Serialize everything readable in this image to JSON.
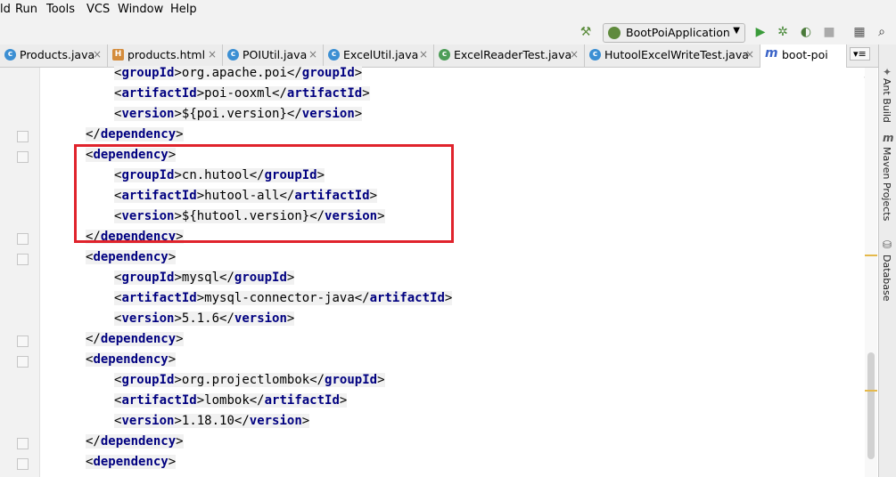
{
  "menu": [
    "Run",
    "Tools",
    "VCS",
    "Window",
    "Help"
  ],
  "menu_partial": "ld",
  "run_config": {
    "label": "BootPoiApplication"
  },
  "toolbar_icons": [
    "hammer-icon",
    "run-icon",
    "debug-icon",
    "coverage-icon",
    "stop-icon",
    "project-structure-icon",
    "search-icon"
  ],
  "tabs": [
    {
      "label": "Products.java",
      "type": "java"
    },
    {
      "label": "products.html",
      "type": "html"
    },
    {
      "label": "POIUtil.java",
      "type": "java"
    },
    {
      "label": "ExcelUtil.java",
      "type": "java"
    },
    {
      "label": "ExcelReaderTest.java",
      "type": "java"
    },
    {
      "label": "HutoolExcelWriteTest.java",
      "type": "java"
    },
    {
      "label": "boot-poi",
      "type": "maven"
    }
  ],
  "tab_overflow": "▾≡",
  "side_tabs": [
    "Ant Build",
    "Maven Projects",
    "Database"
  ],
  "code": [
    {
      "indent": 2,
      "tag": "groupId",
      "value": "org.apache.poi"
    },
    {
      "indent": 2,
      "tag": "artifactId",
      "value": "poi-ooxml"
    },
    {
      "indent": 2,
      "tag": "version",
      "value": "${poi.version}"
    },
    {
      "indent": 1,
      "close": "dependency"
    },
    {
      "indent": 1,
      "open": "dependency"
    },
    {
      "indent": 2,
      "tag": "groupId",
      "value": "cn.hutool"
    },
    {
      "indent": 2,
      "tag": "artifactId",
      "value": "hutool-all"
    },
    {
      "indent": 2,
      "tag": "version",
      "value": "${hutool.version}"
    },
    {
      "indent": 1,
      "close": "dependency"
    },
    {
      "indent": 1,
      "open": "dependency"
    },
    {
      "indent": 2,
      "tag": "groupId",
      "value": "mysql"
    },
    {
      "indent": 2,
      "tag": "artifactId",
      "value": "mysql-connector-java"
    },
    {
      "indent": 2,
      "tag": "version",
      "value": "5.1.6"
    },
    {
      "indent": 1,
      "close": "dependency"
    },
    {
      "indent": 1,
      "open": "dependency"
    },
    {
      "indent": 2,
      "tag": "groupId",
      "value": "org.projectlombok"
    },
    {
      "indent": 2,
      "tag": "artifactId",
      "value": "lombok"
    },
    {
      "indent": 2,
      "tag": "version",
      "value": "1.18.10"
    },
    {
      "indent": 1,
      "close": "dependency"
    },
    {
      "indent": 1,
      "open": "dependency"
    }
  ],
  "colors": {
    "tag": "#000080",
    "highlight_box": "#e0232c"
  }
}
